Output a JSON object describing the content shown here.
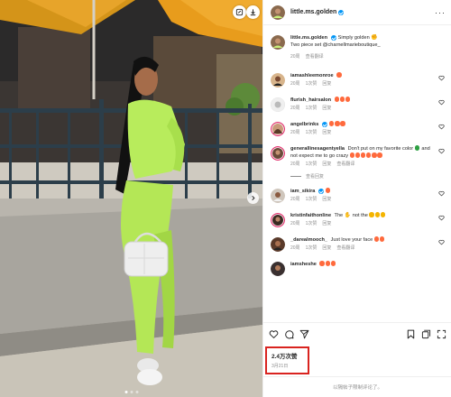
{
  "post": {
    "author": "little.ms.golden",
    "caption_user": "little.ms.golden",
    "caption_line1": "Simply golden",
    "caption_line2": "Two piece set @charnellmarieboutique_",
    "caption_time": "20周",
    "caption_translate": "查看翻译"
  },
  "comments": [
    {
      "user": "iamashleemonroe",
      "text": "",
      "emoji_count": 1,
      "time": "20周",
      "likes": "1次赞",
      "reply": "回复",
      "translate": ""
    },
    {
      "user": "flurish_hairsalon",
      "text": "",
      "emoji_count": 3,
      "time": "20周",
      "likes": "1次赞",
      "reply": "回复",
      "translate": ""
    },
    {
      "user": "angelbrinks",
      "text": "",
      "emoji_count": 3,
      "verified": true,
      "time": "20周",
      "likes": "1次赞",
      "reply": "回复",
      "translate": ""
    },
    {
      "user": "generallinesagentyella",
      "text": "Don't put on my favorite color",
      "text2": "and not expect me to go crazy",
      "emoji_count": 6,
      "time": "20周",
      "likes": "1次赞",
      "reply": "回复",
      "translate": "查看翻译"
    },
    {
      "user": "iam_sikira",
      "text": "",
      "emoji_count": 1,
      "verified": true,
      "time": "20周",
      "likes": "1次赞",
      "reply": "回复",
      "translate": ""
    },
    {
      "user": "kristinfaithonline",
      "text": "The",
      "text_mid": "not the",
      "emoji_count": 3,
      "time": "20周",
      "likes": "1次赞",
      "reply": "回复",
      "translate": ""
    },
    {
      "user": "_darealmooch_",
      "text": "Just love your face",
      "emoji_count": 2,
      "time": "20周",
      "likes": "1次赞",
      "reply": "回复",
      "translate": "查看翻译"
    },
    {
      "user": "iamsheshe",
      "text": "",
      "emoji_count": 3,
      "time": "",
      "likes": "",
      "reply": "",
      "translate": ""
    }
  ],
  "view_replies": "查看回复",
  "stats": {
    "likes": "2.4万次赞",
    "date": "3月21日"
  },
  "footer": {
    "text": "以隔帖子限制评论了。"
  },
  "icons": {
    "like": "heart-icon",
    "comment": "comment-icon",
    "share": "send-icon",
    "save": "bookmark-icon",
    "more": "more-icon"
  },
  "colors": {
    "accent": "#0095f6",
    "highlight_border": "#d9231f",
    "outfit": "#b8ec5c"
  }
}
